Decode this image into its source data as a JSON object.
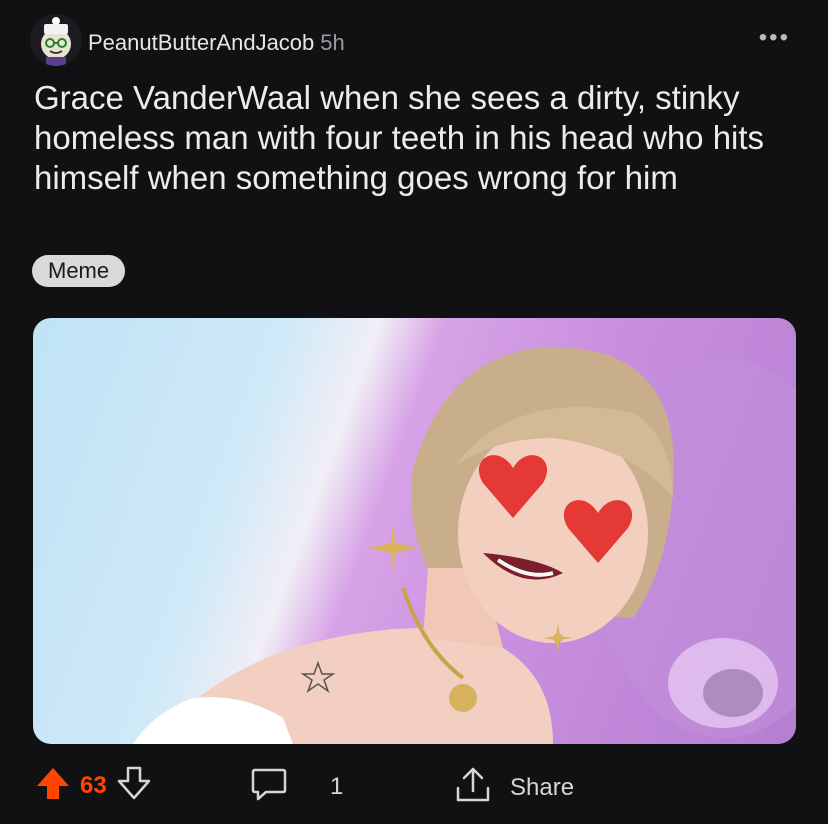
{
  "post": {
    "author": "PeanutButterAndJacob",
    "age": "5h",
    "title": "Grace VanderWaal when she sees a dirty, stinky homeless man with four teeth in his head who hits himself when something goes wrong for him",
    "flair": "Meme",
    "more_icon": "ellipsis-icon"
  },
  "actions": {
    "votes": "63",
    "comments": "1",
    "share_label": "Share"
  },
  "colors": {
    "background": "#111113",
    "upvote": "#ff4500",
    "flair_bg": "#d9d9dc"
  },
  "icons": [
    "avatar-icon",
    "upvote-icon",
    "downvote-icon",
    "comment-icon",
    "share-icon"
  ]
}
